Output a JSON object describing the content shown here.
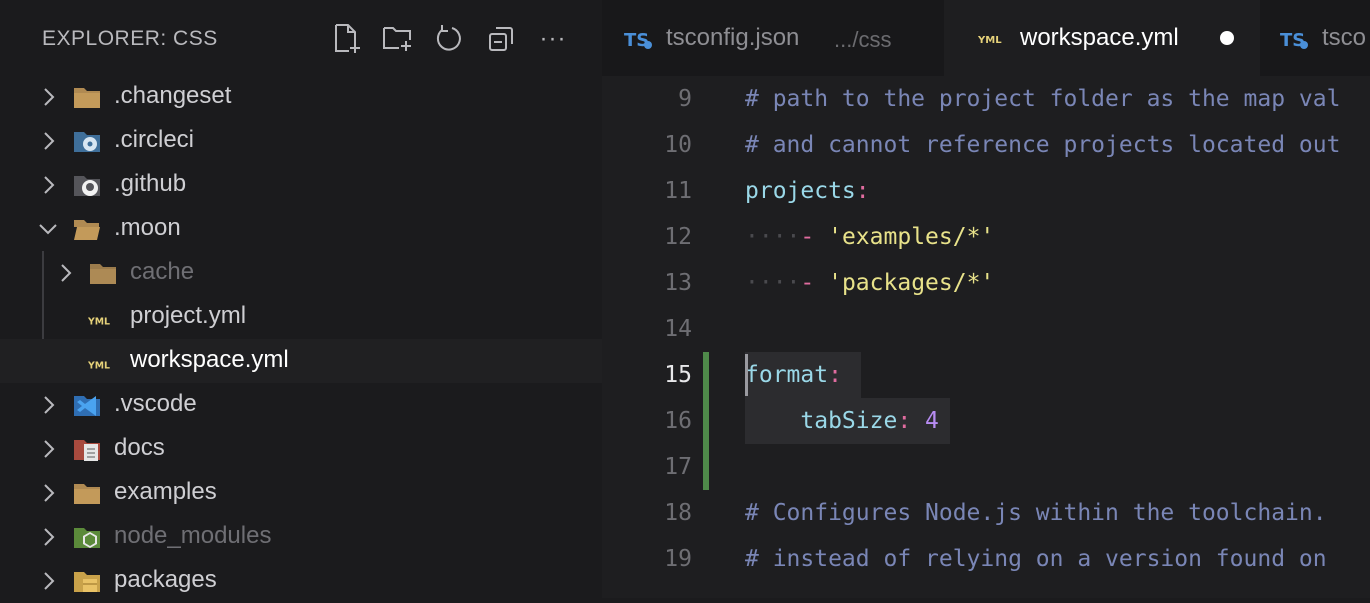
{
  "explorer": {
    "title": "EXPLORER: CSS",
    "actions": [
      {
        "name": "new-file-icon"
      },
      {
        "name": "new-folder-icon"
      },
      {
        "name": "refresh-icon"
      },
      {
        "name": "collapse-all-icon"
      },
      {
        "name": "more-actions-icon",
        "label": "···"
      }
    ],
    "items": [
      {
        "label": ".changeset",
        "icon": "folder-icon",
        "expanded": false
      },
      {
        "label": ".circleci",
        "icon": "circleci-folder-icon",
        "expanded": false
      },
      {
        "label": ".github",
        "icon": "github-folder-icon",
        "expanded": false
      },
      {
        "label": ".moon",
        "icon": "folder-open-icon",
        "expanded": true
      },
      {
        "label": "cache",
        "icon": "folder-icon",
        "expanded": false,
        "ignored": true
      },
      {
        "label": "project.yml",
        "icon": "yaml-file-icon"
      },
      {
        "label": "workspace.yml",
        "icon": "yaml-file-icon",
        "active": true
      },
      {
        "label": ".vscode",
        "icon": "vscode-folder-icon",
        "expanded": false
      },
      {
        "label": "docs",
        "icon": "docs-folder-icon",
        "expanded": false
      },
      {
        "label": "examples",
        "icon": "folder-icon",
        "expanded": false
      },
      {
        "label": "node_modules",
        "icon": "node-folder-icon",
        "expanded": false,
        "ignored": true
      },
      {
        "label": "packages",
        "icon": "packages-folder-icon",
        "expanded": false
      }
    ]
  },
  "tabs": [
    {
      "name": "tsconfig.json",
      "description": ".../css",
      "icon": "typescript-config-icon",
      "active": false
    },
    {
      "name": "workspace.yml",
      "icon": "yaml-file-icon",
      "active": true,
      "dirty": true
    },
    {
      "name": "tsco",
      "icon": "typescript-config-icon",
      "active": false
    }
  ],
  "editor": {
    "current_line": 15,
    "lines": [
      {
        "n": "9",
        "text": "# path to the project folder as the map val"
      },
      {
        "n": "10",
        "text": "# and cannot reference projects located out"
      },
      {
        "n": "11",
        "text": "projects:"
      },
      {
        "n": "12",
        "text": "    - 'examples/*'"
      },
      {
        "n": "13",
        "text": "    - 'packages/*'"
      },
      {
        "n": "14",
        "text": ""
      },
      {
        "n": "15",
        "text": "format:"
      },
      {
        "n": "16",
        "text": "    tabSize: 4"
      },
      {
        "n": "17",
        "text": ""
      },
      {
        "n": "18",
        "text": "# Configures Node.js within the toolchain."
      },
      {
        "n": "19",
        "text": "# instead of relying on a version found on"
      }
    ]
  },
  "colors": {
    "background": "#1b1b1d",
    "comment": "#7a86b6",
    "key": "#9ad8e8",
    "punctuation": "#e06c9f",
    "string": "#e8e28a",
    "number": "#b78cf2",
    "git_modified": "#4f8a4a",
    "folder": "#c39a5a"
  }
}
